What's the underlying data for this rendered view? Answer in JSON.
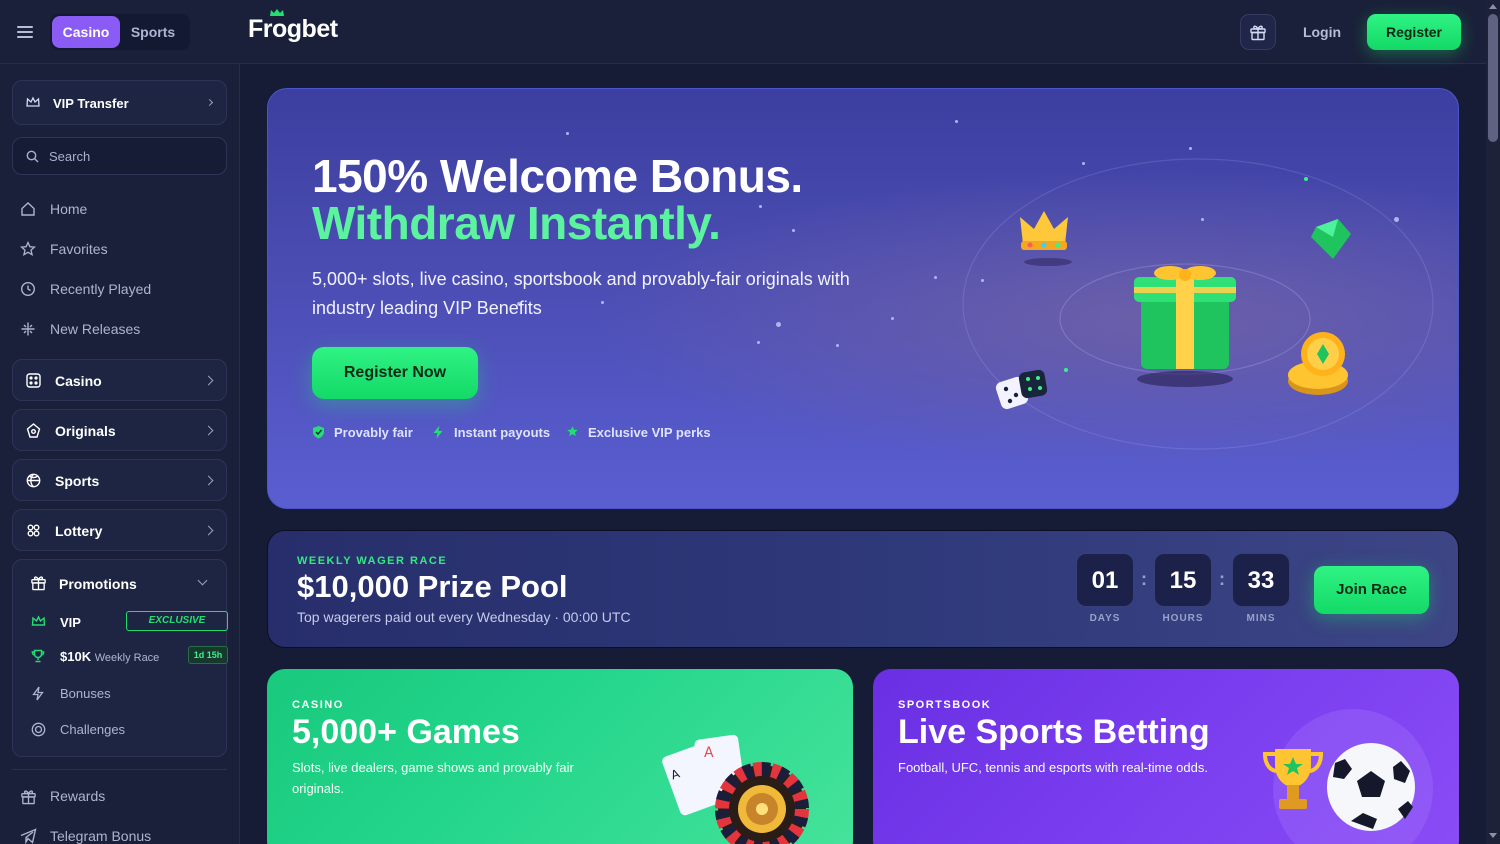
{
  "header": {
    "tabs": [
      {
        "label": "Casino",
        "active": true
      },
      {
        "label": "Sports",
        "active": false
      }
    ],
    "logo": "Frogbet",
    "login_label": "Login",
    "register_label": "Register"
  },
  "sidebar": {
    "vip_transfer": "VIP Transfer",
    "search_placeholder": "Search",
    "nav": [
      "Home",
      "Favorites",
      "Recently Played",
      "New Releases"
    ],
    "categories": [
      "Casino",
      "Originals",
      "Sports",
      "Lottery"
    ],
    "promotions": {
      "label": "Promotions",
      "vip_label": "VIP",
      "vip_badge": "EXCLUSIVE",
      "race_amount": "$10K",
      "race_label": "Weekly Race",
      "race_badge": "1d 15h",
      "bonuses": "Bonuses",
      "challenges": "Challenges"
    },
    "rewards": "Rewards",
    "telegram": "Telegram Bonus"
  },
  "hero": {
    "title_line1": "150% Welcome Bonus.",
    "title_line2": "Withdraw Instantly.",
    "subtitle": "5,000+ slots, live casino, sportsbook and provably-fair originals with industry leading VIP Benefits",
    "cta": "Register Now",
    "features": [
      "Provably fair",
      "Instant payouts",
      "Exclusive VIP perks"
    ]
  },
  "race": {
    "kicker": "WEEKLY WAGER RACE",
    "title": "$10,000 Prize Pool",
    "subtitle": "Top wagerers paid out every Wednesday · 00:00 UTC",
    "countdown": [
      {
        "value": "01",
        "label": "DAYS"
      },
      {
        "value": "15",
        "label": "HOURS"
      },
      {
        "value": "33",
        "label": "MINS"
      }
    ],
    "join_label": "Join Race"
  },
  "cards": [
    {
      "kicker": "CASINO",
      "title": "5,000+ Games",
      "subtitle": "Slots, live dealers, game shows and provably fair originals."
    },
    {
      "kicker": "SPORTSBOOK",
      "title": "Live Sports Betting",
      "subtitle": "Football, UFC, tennis and esports with real-time odds."
    }
  ],
  "colors": {
    "accent_green": "#1fdc6b",
    "accent_purple": "#8a5cf5",
    "background": "#171c36"
  }
}
